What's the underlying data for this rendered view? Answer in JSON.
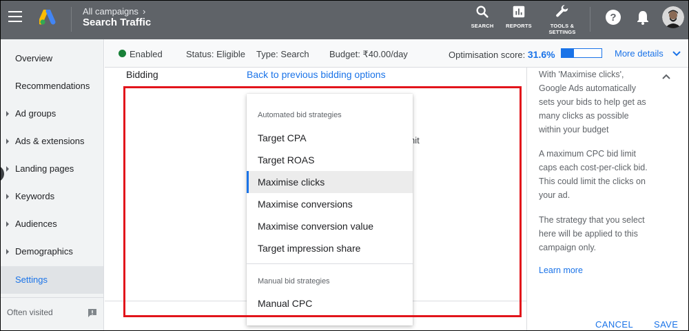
{
  "header": {
    "breadcrumb": "All campaigns",
    "title": "Search Traffic",
    "tools": {
      "search_label": "SEARCH",
      "reports_label": "REPORTS",
      "tools_label_1": "TOOLS &",
      "tools_label_2": "SETTINGS"
    }
  },
  "sidebar": {
    "items": [
      {
        "label": "Overview"
      },
      {
        "label": "Recommendations"
      },
      {
        "label": "Ad groups"
      },
      {
        "label": "Ads & extensions"
      },
      {
        "label": "Landing pages"
      },
      {
        "label": "Keywords"
      },
      {
        "label": "Audiences"
      },
      {
        "label": "Demographics"
      },
      {
        "label": "Settings"
      }
    ],
    "often_visited": "Often visited"
  },
  "status_bar": {
    "enabled": "Enabled",
    "status": "Status: Eligible",
    "type": "Type: Search",
    "budget": "Budget: ₹40.00/day",
    "optimisation_label": "Optimisation score:",
    "optimisation_score": "31.6%",
    "optimisation_fraction": 0.316,
    "more_details": "More details"
  },
  "main": {
    "bidding_label": "Bidding",
    "back_link": "Back to previous bidding options",
    "partial_text": "nit"
  },
  "menu": {
    "automated_header": "Automated bid strategies",
    "automated": [
      "Target CPA",
      "Target ROAS",
      "Maximise clicks",
      "Maximise conversions",
      "Maximise conversion value",
      "Target impression share"
    ],
    "selected": "Maximise clicks",
    "manual_header": "Manual bid strategies",
    "manual": [
      "Manual CPC"
    ]
  },
  "help_panel": {
    "p1": "With 'Maximise clicks', Google Ads automatically sets your bids to help get as many clicks as possible within your budget",
    "p2": "A maximum CPC bid limit caps each cost-per-click bid. This could limit the clicks on your ad.",
    "p3": "The strategy that you select here will be applied to this campaign only.",
    "learn_more": "Learn more"
  },
  "actions": {
    "cancel": "CANCEL",
    "save": "SAVE"
  },
  "colors": {
    "accent": "#1a73e8",
    "topbar": "#5f6368",
    "enabled_dot": "#188038",
    "highlight_box": "#e2141b"
  },
  "icons": [
    "menu-icon",
    "google-ads-logo",
    "search-icon",
    "reports-icon",
    "wrench-icon",
    "help-icon",
    "bell-icon",
    "avatar",
    "feedback-icon",
    "chevron-down-icon",
    "chevron-up-icon"
  ]
}
